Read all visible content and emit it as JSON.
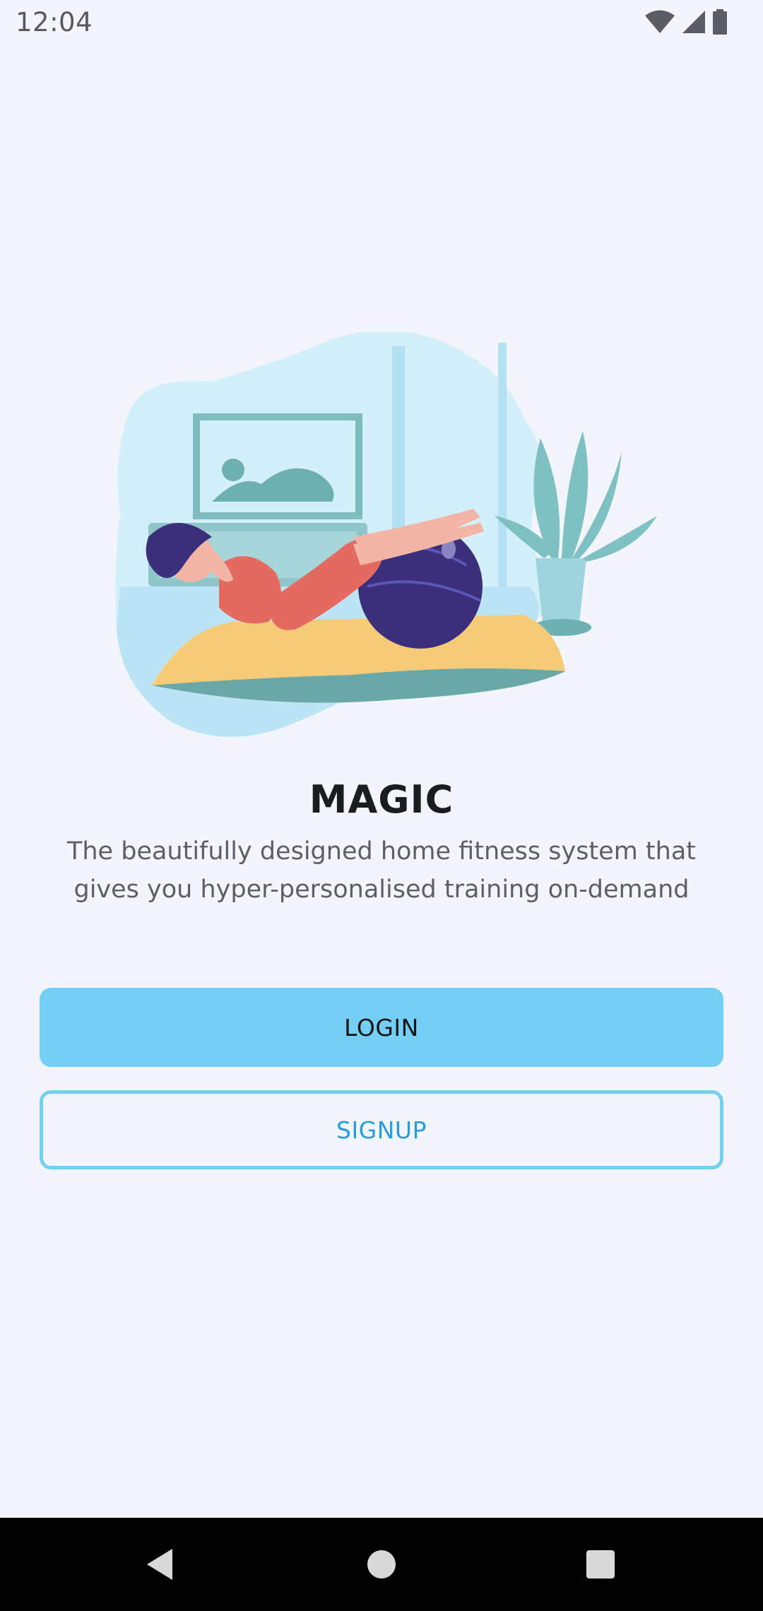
{
  "status_bar": {
    "time": "12:04",
    "icons": [
      "wifi-icon",
      "cell-signal-icon",
      "battery-icon"
    ]
  },
  "illustration": {
    "subject": "woman-exercise-ball-illustration"
  },
  "main": {
    "title": "MAGIC",
    "subtitle": "The beautifully designed home fitness system that gives you hyper-personalised training on-demand"
  },
  "buttons": {
    "login_label": "LOGIN",
    "signup_label": "SIGNUP"
  },
  "nav_bar": {
    "icons": [
      "back-triangle-icon",
      "home-circle-icon",
      "recents-square-icon"
    ]
  },
  "colors": {
    "background": "#f2f5fa",
    "accent": "#74cff3",
    "signup_text": "#2b9be0",
    "title": "#1b1c1f"
  }
}
